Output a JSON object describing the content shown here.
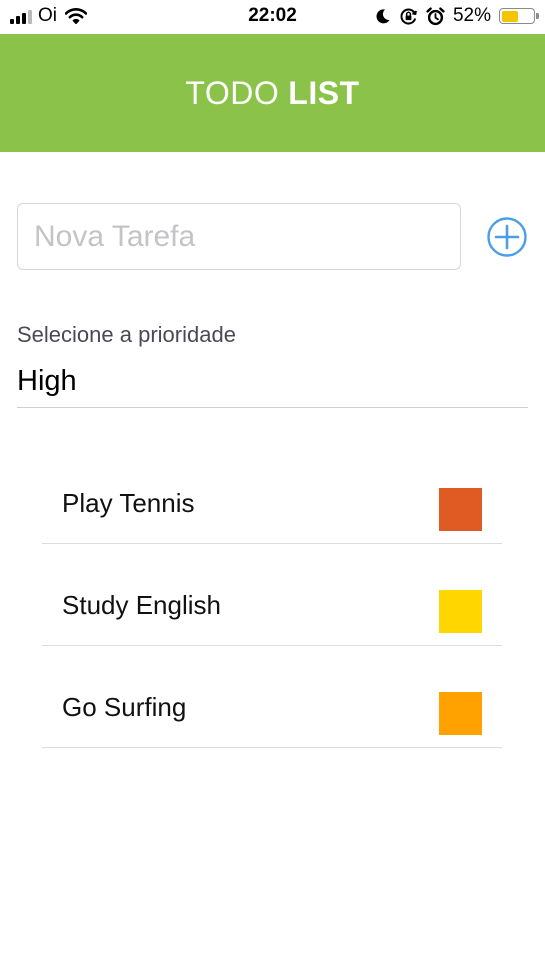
{
  "status_bar": {
    "carrier": "Oi",
    "time": "22:02",
    "battery": "52%",
    "battery_level": 0.52,
    "icons": [
      "signal-icon",
      "wifi-icon",
      "moon-icon",
      "orientation-lock-icon",
      "alarm-icon",
      "battery-icon"
    ]
  },
  "header": {
    "title_part1": "TODO",
    "title_part2": "LIST",
    "background": "#8bc34a"
  },
  "new_task": {
    "placeholder": "Nova Tarefa",
    "value": "",
    "add_icon": "plus-circle-icon",
    "accent": "#4a9ee8"
  },
  "priority": {
    "label": "Selecione a prioridade",
    "selected": "High"
  },
  "tasks": [
    {
      "name": "Play Tennis",
      "color": "#e05a24"
    },
    {
      "name": "Study English",
      "color": "#ffd600"
    },
    {
      "name": "Go Surfing",
      "color": "#ffa200"
    }
  ]
}
